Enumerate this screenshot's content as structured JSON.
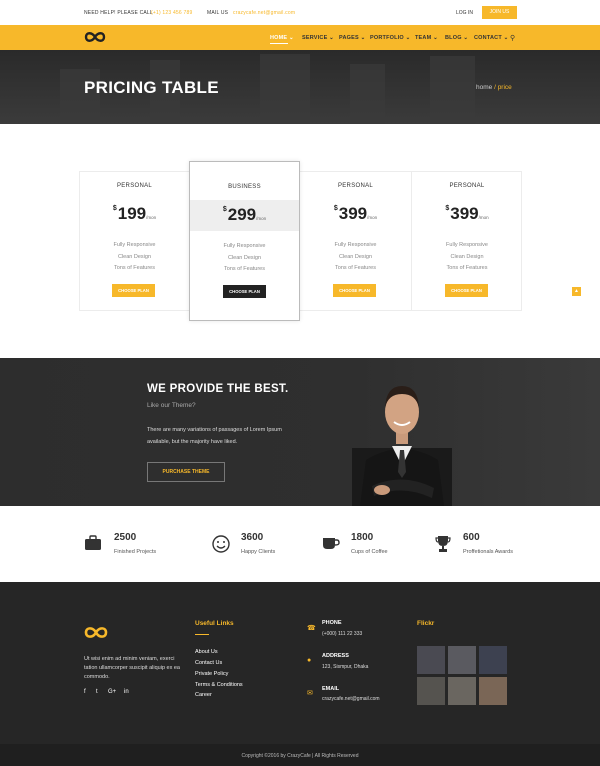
{
  "topbar": {
    "help_label": "NEED HELP! PLEASE CALL",
    "phone": "(+1) 123 456 789",
    "mail_label": "MAIL US",
    "email": "crazycafe.net@gmail.com",
    "login_label": "LOG IN",
    "join_label": "JOIN US"
  },
  "nav": {
    "items": [
      {
        "label": "HOME"
      },
      {
        "label": "SERVICE"
      },
      {
        "label": "PAGES"
      },
      {
        "label": "PORTFOLIO"
      },
      {
        "label": "TEAM"
      },
      {
        "label": "BLOG"
      },
      {
        "label": "CONTACT"
      }
    ]
  },
  "hero": {
    "title": "PRICING TABLE",
    "crumb_home": "home",
    "crumb_current": "/ price"
  },
  "pricing": {
    "currency": "$",
    "per": "/mon",
    "plans": [
      {
        "name": "PERSONAL",
        "price": "199",
        "features": [
          "Fully Responsive",
          "Clean Design",
          "Tons of Features"
        ],
        "button": "CHOOSE PLAN"
      },
      {
        "name": "BUSINESS",
        "price": "299",
        "features": [
          "Fully Responsive",
          "Clean Design",
          "Tons of Features"
        ],
        "button": "CHOOSE PLAN"
      },
      {
        "name": "PERSONAL",
        "price": "399",
        "features": [
          "Fully Responsive",
          "Clean Design",
          "Tons of Features"
        ],
        "button": "CHOOSE PLAN"
      },
      {
        "name": "PERSONAL",
        "price": "399",
        "features": [
          "Fully Responsive",
          "Clean Design",
          "Tons of Features"
        ],
        "button": "CHOOSE PLAN"
      }
    ]
  },
  "best": {
    "title": "WE PROVIDE THE BEST.",
    "subtitle": "Like our Theme?",
    "text": "There are many variations of passages of Lorem Ipsum available, but the majority have liked.",
    "button": "PURCHASE THEME"
  },
  "stats": [
    {
      "num": "2500",
      "label": "Finished Projects",
      "icon": "briefcase-icon"
    },
    {
      "num": "3600",
      "label": "Happy Clients",
      "icon": "smiley-icon"
    },
    {
      "num": "1800",
      "label": "Cups of Coffee",
      "icon": "coffee-cup-icon"
    },
    {
      "num": "600",
      "label": "Proffetionals Awards",
      "icon": "trophy-icon"
    }
  ],
  "footer": {
    "about": "Ut wisi enim ad minim veniam, exerci tation ullamcorper suscipit aliquip ex ea commodo.",
    "social": [
      "f",
      "t",
      "G+",
      "in"
    ],
    "useful_title": "Useful Links",
    "links": [
      "About Us",
      "Contact Us",
      "Private Policy",
      "Terms & Conditions",
      "Career"
    ],
    "phone_label": "PHONE",
    "phone_value": "(+000) 111 22 333",
    "address_label": "ADDRESS",
    "address_value": "123, Sismpur, Dhaka",
    "email_label": "EMAIL",
    "email_value": "crazycafe.net@gmail.com",
    "flickr_title": "Flickr",
    "copyright": "Copyright ©2016 by CrazyCafe   |   All Rights Reserved"
  },
  "colors": {
    "accent": "#f7b82a",
    "dark": "#262626"
  }
}
